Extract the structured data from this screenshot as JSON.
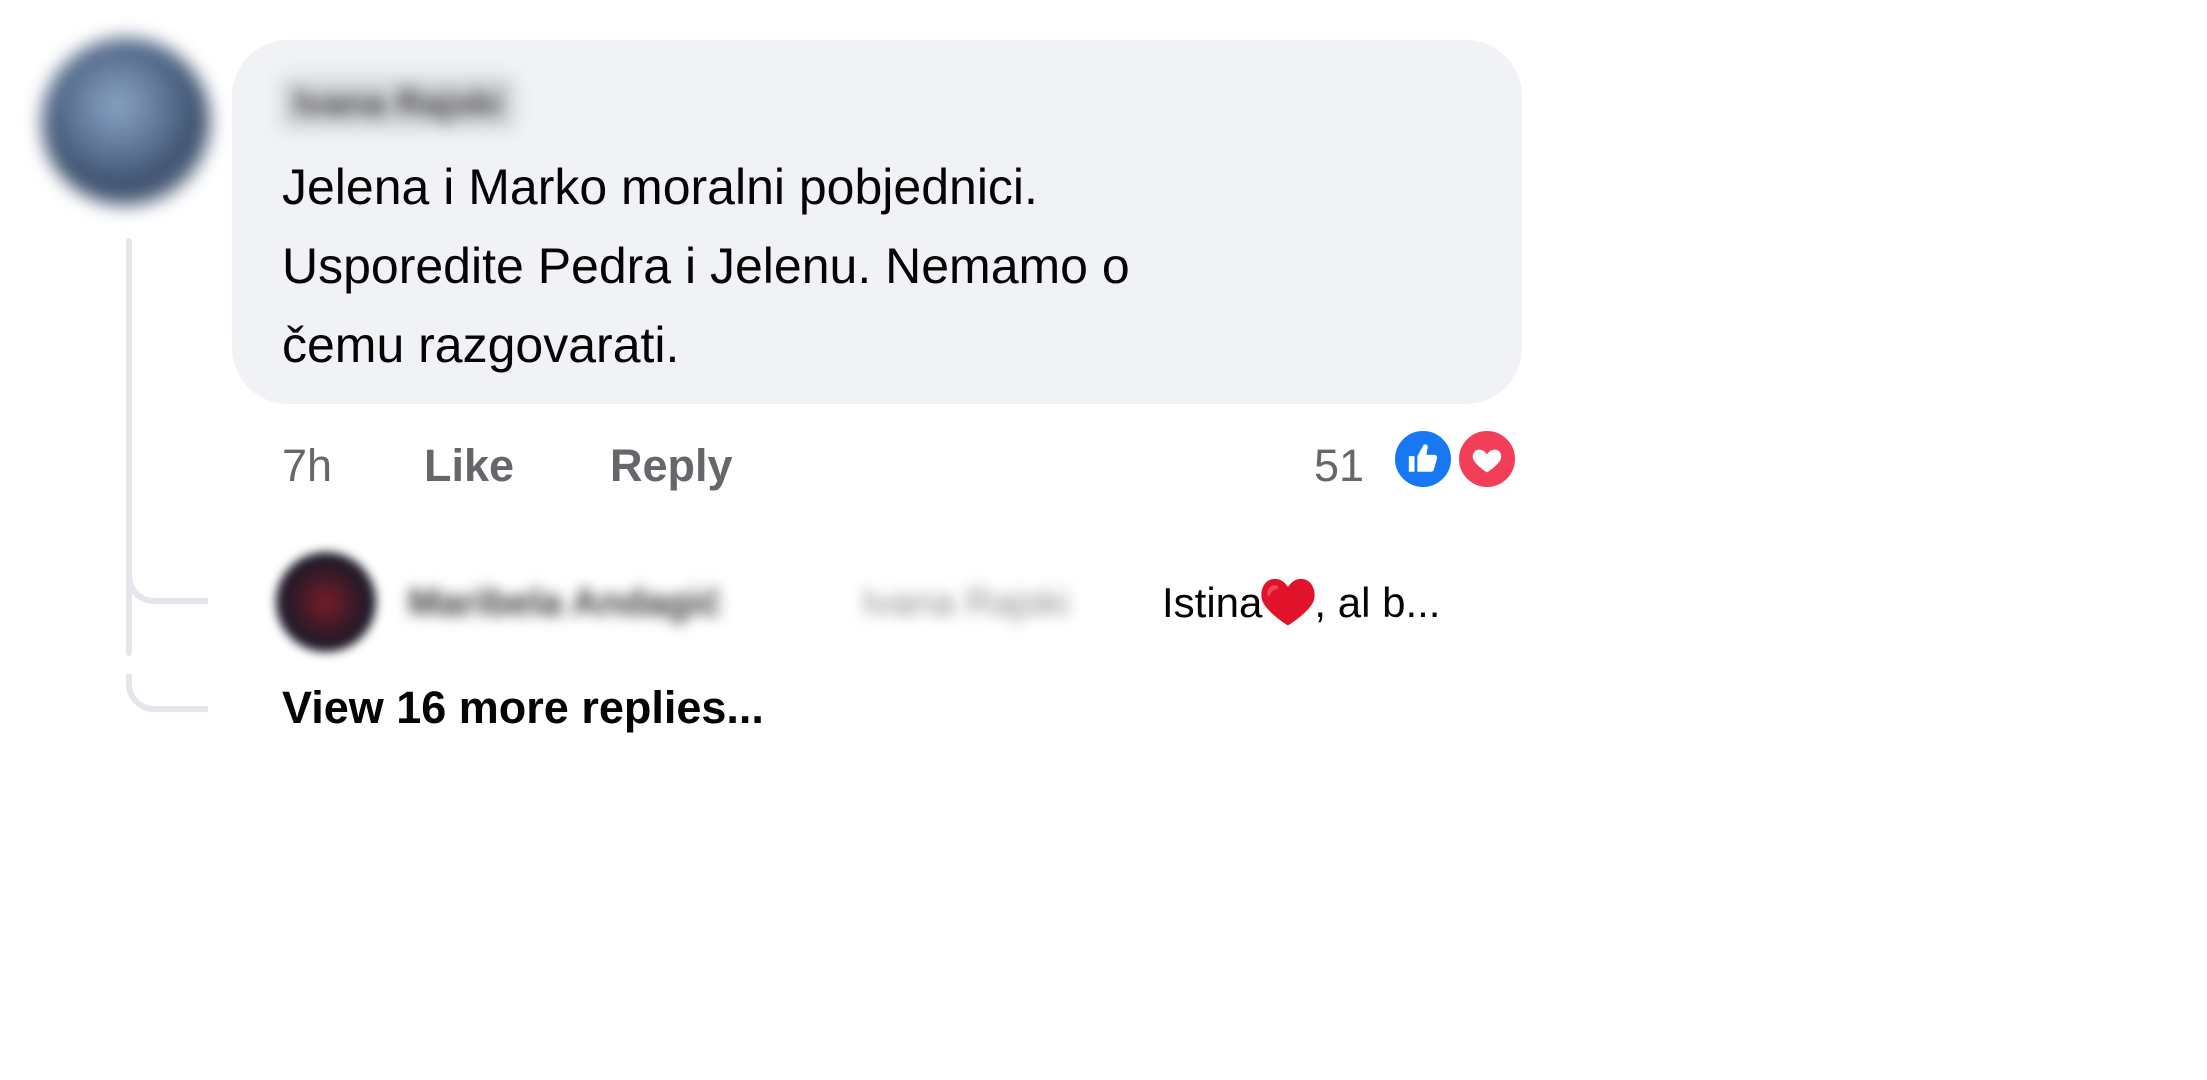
{
  "comment": {
    "author": "Ivana Rajski",
    "text_lines": [
      "Jelena i Marko moralni pobjednici.",
      "Usporedite Pedra i Jelenu. Nemamo o",
      "čemu razgovarati."
    ],
    "time": "7h",
    "like_label": "Like",
    "reply_label": "Reply",
    "reaction_count": "51",
    "reactions": [
      "like-icon",
      "love-icon"
    ]
  },
  "reply": {
    "author": "Maribela Andagić",
    "mention": "Ivana Rajski",
    "snippet_before": "Istina",
    "snippet_after": ", al b..."
  },
  "view_more_label": "View 16 more replies...",
  "colors": {
    "bubble": "#f0f2f5",
    "like": "#1877f2",
    "love": "#f33e58",
    "secondary_text": "#65676b"
  }
}
